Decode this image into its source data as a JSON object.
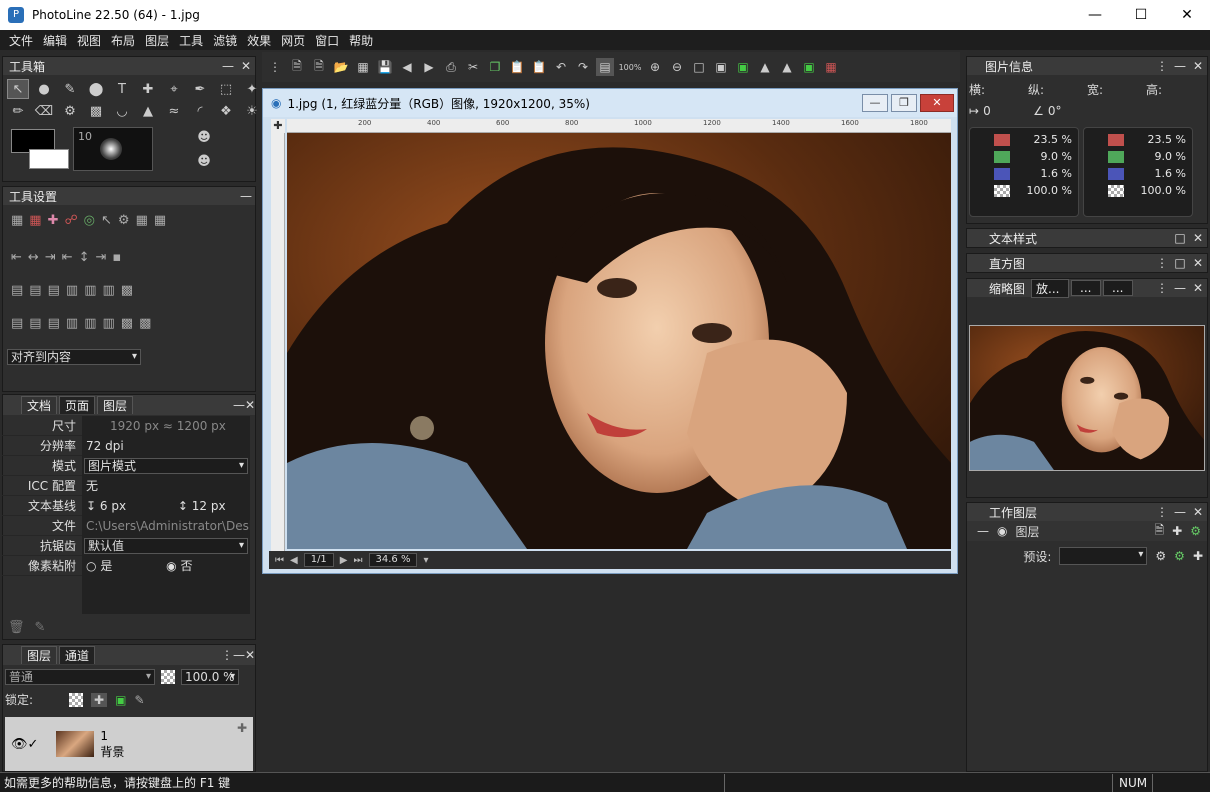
{
  "window": {
    "title": "PhotoLine 22.50 (64) - 1.jpg",
    "app_icon": "P"
  },
  "menu": [
    "文件",
    "编辑",
    "视图",
    "布局",
    "图层",
    "工具",
    "滤镜",
    "效果",
    "网页",
    "窗口",
    "帮助"
  ],
  "toolbox": {
    "title": "工具箱",
    "brush_size": "10"
  },
  "tool_settings": {
    "title": "工具设置",
    "align_dropdown": "对齐到内容"
  },
  "doc_panel": {
    "tabs": [
      "文档",
      "页面",
      "图层"
    ],
    "rows": {
      "size_label": "尺寸",
      "size_w": "1920 px",
      "size_h": "1200 px",
      "dpi_label": "分辨率",
      "dpi_value": "72 dpi",
      "mode_label": "模式",
      "mode_value": "图片模式",
      "icc_label": "ICC 配置",
      "icc_value": "无",
      "baseline_label": "文本基线",
      "baseline_1": "6 px",
      "baseline_2": "12 px",
      "file_label": "文件",
      "file_value": "C:\\Users\\Administrator\\Deskto",
      "aa_label": "抗锯齿",
      "aa_value": "默认值",
      "snap_label": "像素粘附",
      "snap_yes": "是",
      "snap_no": "否"
    }
  },
  "layers_panel": {
    "tabs": [
      "图层",
      "通道"
    ],
    "blend_mode": "普通",
    "opacity": "100.0 %",
    "lock_label": "锁定:",
    "layer_name": "1",
    "layer_sub": "背景"
  },
  "toolbar": {
    "zoom_label": "100%"
  },
  "document": {
    "title": "1.jpg (1, 红绿蓝分量（RGB）图像, 1920x1200, 35%)",
    "ruler_marks": [
      "200",
      "400",
      "600",
      "800",
      "1000",
      "1200",
      "1400",
      "1600",
      "1800"
    ],
    "page": "1/1",
    "zoom": "34.6 %"
  },
  "image_info": {
    "title": "图片信息",
    "h_label": "横:",
    "v_label": "纵:",
    "w_label": "宽:",
    "ht_label": "高:",
    "offset": "0",
    "angle": "0°",
    "left": [
      {
        "color": "#c0504d",
        "value": "23.5 %"
      },
      {
        "color": "#4fa85a",
        "value": "9.0 %"
      },
      {
        "color": "#4b55b8",
        "value": "1.6 %"
      },
      {
        "color": "checker",
        "value": "100.0 %"
      }
    ],
    "right": [
      {
        "color": "#c0504d",
        "value": "23.5 %"
      },
      {
        "color": "#4fa85a",
        "value": "9.0 %"
      },
      {
        "color": "#4b55b8",
        "value": "1.6 %"
      },
      {
        "color": "checker",
        "value": "100.0 %"
      }
    ]
  },
  "text_style": {
    "title": "文本样式"
  },
  "histogram": {
    "title": "直方图"
  },
  "thumbnail": {
    "title": "缩略图",
    "zoom": "放...",
    "b1": "...",
    "b2": "..."
  },
  "work_layers": {
    "title": "工作图层",
    "layer": "图层",
    "preset_label": "预设:"
  },
  "status": {
    "help": "如需更多的帮助信息，请按键盘上的 F1 键",
    "num": "NUM"
  }
}
